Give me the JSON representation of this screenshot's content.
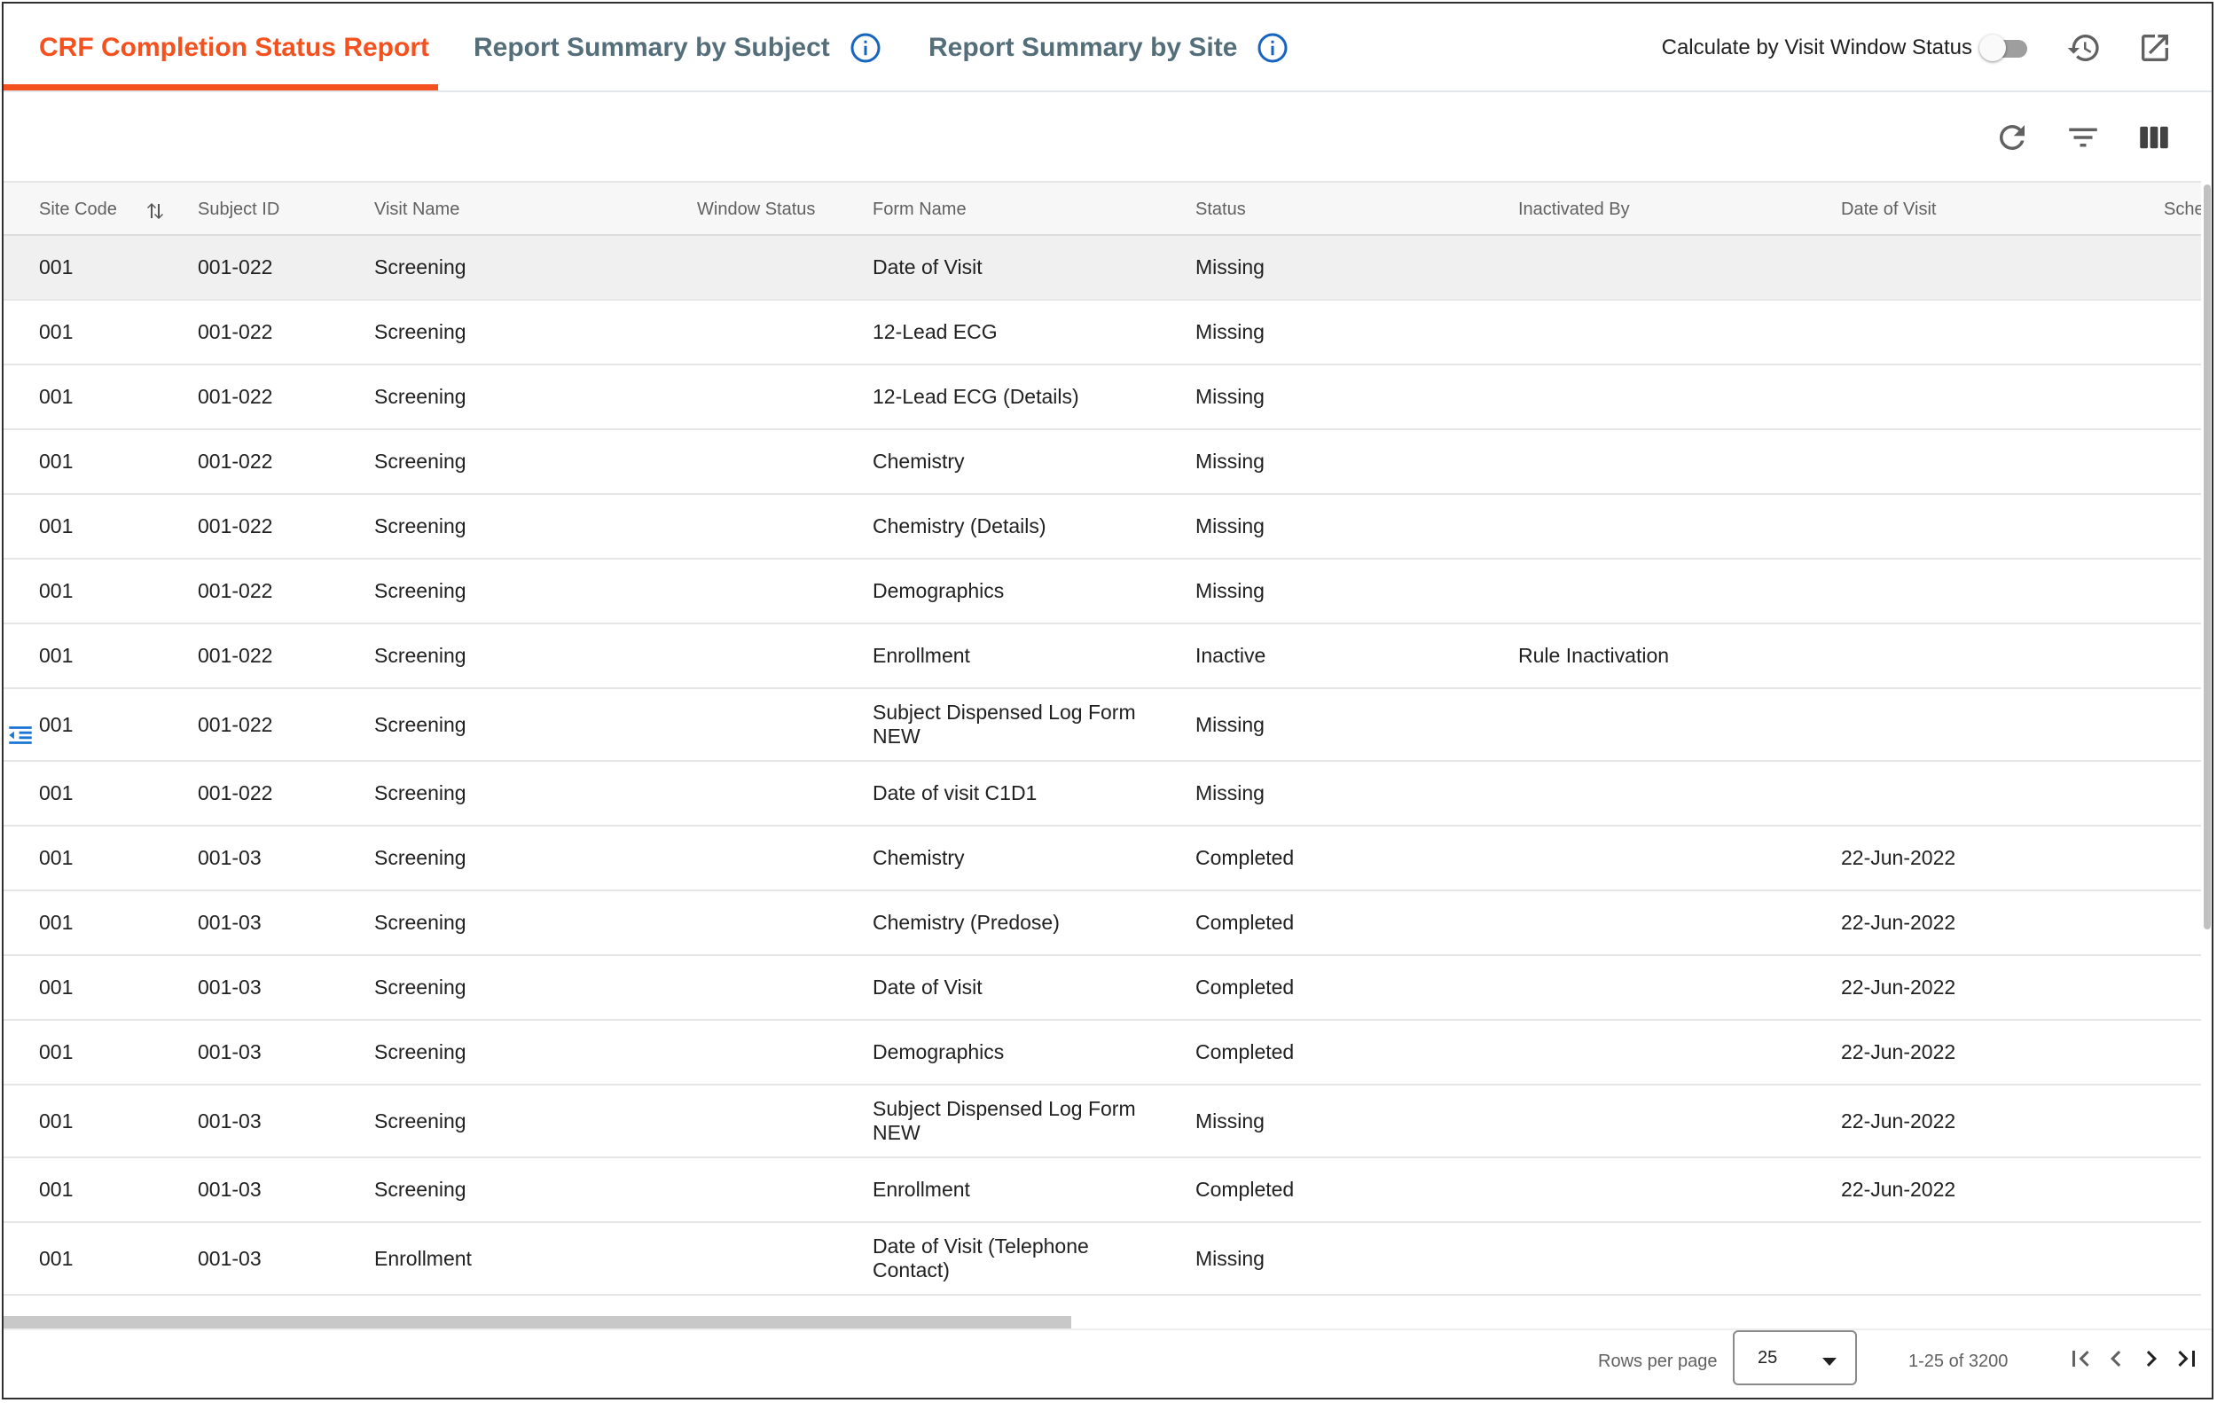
{
  "tabs": [
    {
      "label": "CRF Completion Status Report",
      "active": true
    },
    {
      "label": "Report Summary by Subject",
      "active": false
    },
    {
      "label": "Report Summary by Site",
      "active": false
    }
  ],
  "toolbar": {
    "toggle_label": "Calculate by Visit Window Status",
    "toggle_on": false,
    "icons": [
      "history-icon",
      "open-in-new-icon"
    ]
  },
  "grid_tools": {
    "icons": [
      "refresh-icon",
      "filter-icon",
      "columns-icon"
    ]
  },
  "columns": [
    "Site Code",
    "Subject ID",
    "Visit Name",
    "Window Status",
    "Form Name",
    "Status",
    "Inactivated By",
    "Date of Visit",
    "Sche"
  ],
  "rows": [
    {
      "site": "001",
      "subject": "001-022",
      "visit": "Screening",
      "window": "",
      "form": "Date of Visit",
      "status": "Missing",
      "inactivated_by": "",
      "date": ""
    },
    {
      "site": "001",
      "subject": "001-022",
      "visit": "Screening",
      "window": "",
      "form": "12-Lead ECG",
      "status": "Missing",
      "inactivated_by": "",
      "date": ""
    },
    {
      "site": "001",
      "subject": "001-022",
      "visit": "Screening",
      "window": "",
      "form": "12-Lead ECG (Details)",
      "status": "Missing",
      "inactivated_by": "",
      "date": ""
    },
    {
      "site": "001",
      "subject": "001-022",
      "visit": "Screening",
      "window": "",
      "form": "Chemistry",
      "status": "Missing",
      "inactivated_by": "",
      "date": ""
    },
    {
      "site": "001",
      "subject": "001-022",
      "visit": "Screening",
      "window": "",
      "form": "Chemistry (Details)",
      "status": "Missing",
      "inactivated_by": "",
      "date": ""
    },
    {
      "site": "001",
      "subject": "001-022",
      "visit": "Screening",
      "window": "",
      "form": "Demographics",
      "status": "Missing",
      "inactivated_by": "",
      "date": ""
    },
    {
      "site": "001",
      "subject": "001-022",
      "visit": "Screening",
      "window": "",
      "form": "Enrollment",
      "status": "Inactive",
      "inactivated_by": "Rule Inactivation",
      "date": ""
    },
    {
      "site": "001",
      "subject": "001-022",
      "visit": "Screening",
      "window": "",
      "form": "Subject Dispensed Log Form NEW",
      "status": "Missing",
      "inactivated_by": "",
      "date": ""
    },
    {
      "site": "001",
      "subject": "001-022",
      "visit": "Screening",
      "window": "",
      "form": "Date of visit C1D1",
      "status": "Missing",
      "inactivated_by": "",
      "date": ""
    },
    {
      "site": "001",
      "subject": "001-03",
      "visit": "Screening",
      "window": "",
      "form": "Chemistry",
      "status": "Completed",
      "inactivated_by": "",
      "date": "22-Jun-2022"
    },
    {
      "site": "001",
      "subject": "001-03",
      "visit": "Screening",
      "window": "",
      "form": "Chemistry (Predose)",
      "status": "Completed",
      "inactivated_by": "",
      "date": "22-Jun-2022"
    },
    {
      "site": "001",
      "subject": "001-03",
      "visit": "Screening",
      "window": "",
      "form": "Date of Visit",
      "status": "Completed",
      "inactivated_by": "",
      "date": "22-Jun-2022"
    },
    {
      "site": "001",
      "subject": "001-03",
      "visit": "Screening",
      "window": "",
      "form": "Demographics",
      "status": "Completed",
      "inactivated_by": "",
      "date": "22-Jun-2022"
    },
    {
      "site": "001",
      "subject": "001-03",
      "visit": "Screening",
      "window": "",
      "form": "Subject Dispensed Log Form NEW",
      "status": "Missing",
      "inactivated_by": "",
      "date": "22-Jun-2022"
    },
    {
      "site": "001",
      "subject": "001-03",
      "visit": "Screening",
      "window": "",
      "form": "Enrollment",
      "status": "Completed",
      "inactivated_by": "",
      "date": "22-Jun-2022"
    },
    {
      "site": "001",
      "subject": "001-03",
      "visit": "Enrollment",
      "window": "",
      "form": "Date of Visit (Telephone Contact)",
      "status": "Missing",
      "inactivated_by": "",
      "date": ""
    }
  ],
  "pagination": {
    "rows_per_page_label": "Rows per page",
    "rows_per_page": "25",
    "range": "1-25 of 3200"
  },
  "colors": {
    "accent": "#f4511e",
    "tab_inactive": "#546e7a",
    "info": "#1565c0"
  }
}
